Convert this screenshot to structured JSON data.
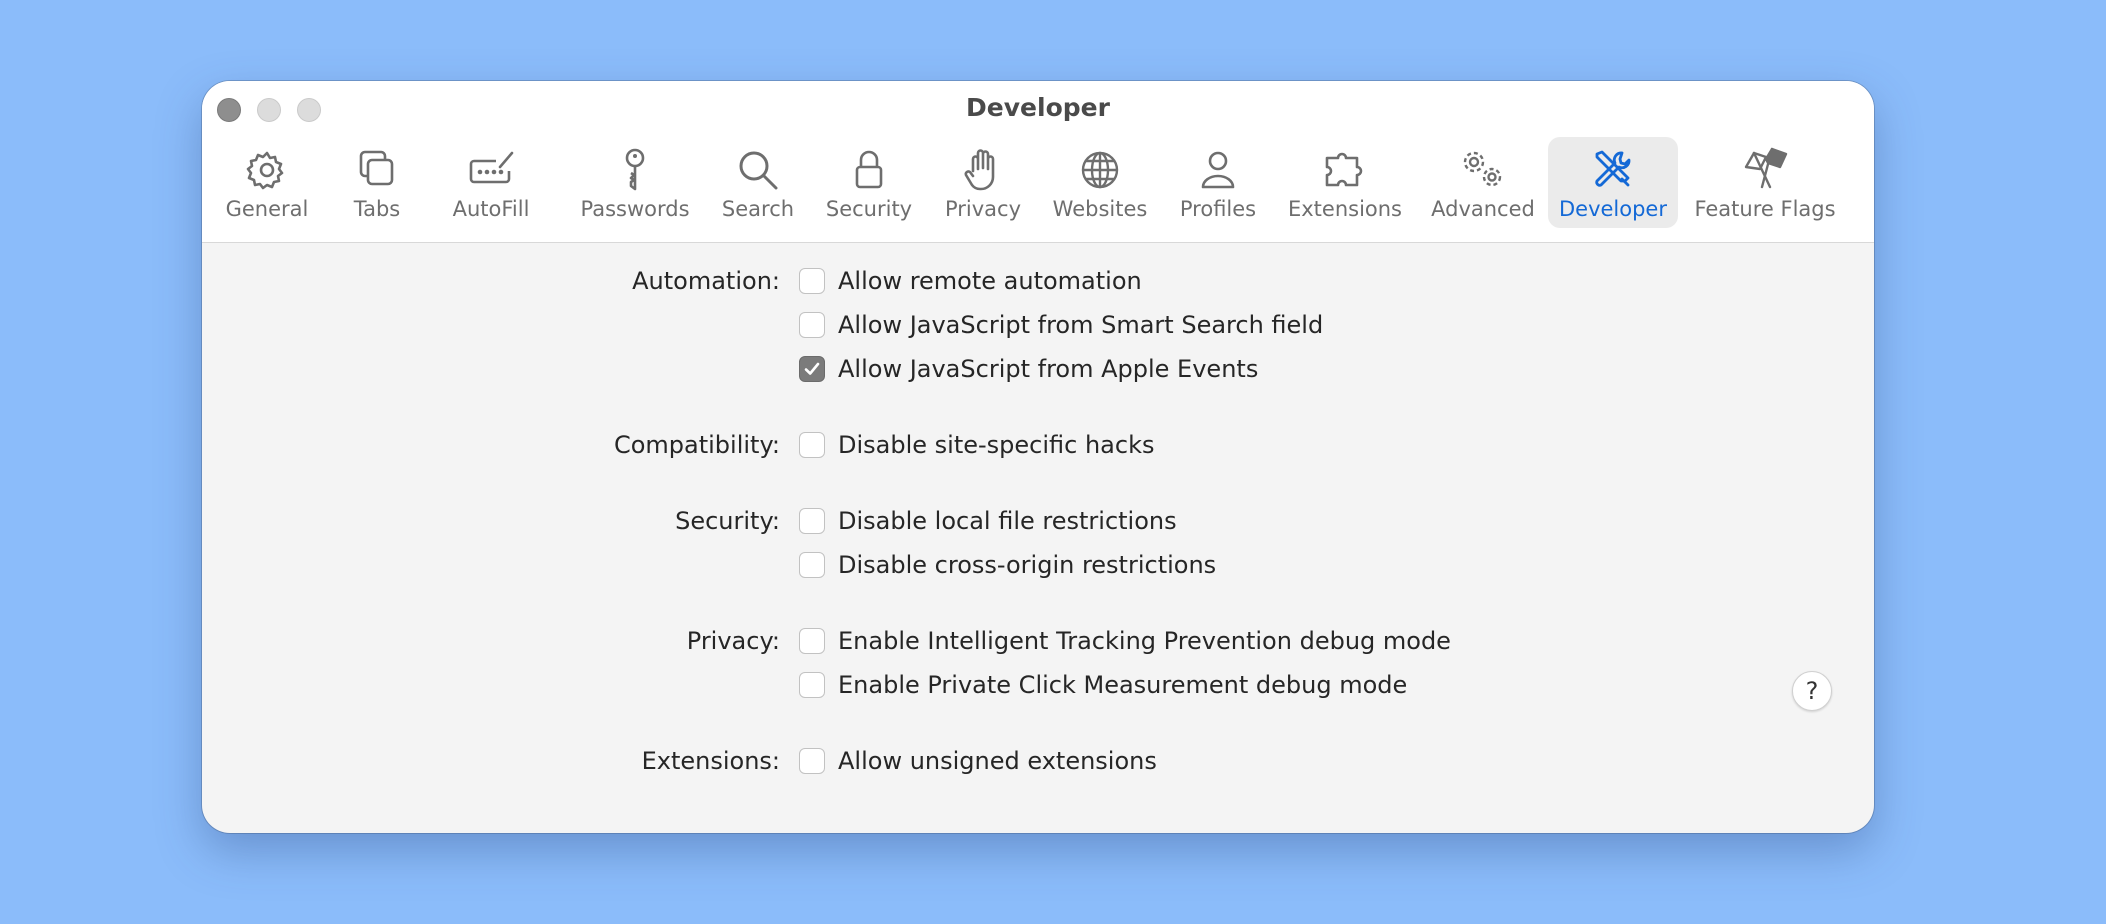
{
  "window": {
    "title": "Developer",
    "accent_color": "#1469d6"
  },
  "toolbar": {
    "items": [
      {
        "label": "General",
        "icon": "gear-icon"
      },
      {
        "label": "Tabs",
        "icon": "tabs-icon"
      },
      {
        "label": "AutoFill",
        "icon": "autofill-icon"
      },
      {
        "label": "Passwords",
        "icon": "key-icon"
      },
      {
        "label": "Search",
        "icon": "magnifier-icon"
      },
      {
        "label": "Security",
        "icon": "lock-icon"
      },
      {
        "label": "Privacy",
        "icon": "hand-icon"
      },
      {
        "label": "Websites",
        "icon": "globe-icon"
      },
      {
        "label": "Profiles",
        "icon": "person-icon"
      },
      {
        "label": "Extensions",
        "icon": "puzzle-icon"
      },
      {
        "label": "Advanced",
        "icon": "gears-icon"
      },
      {
        "label": "Developer",
        "icon": "tools-icon",
        "selected": true
      },
      {
        "label": "Feature Flags",
        "icon": "flags-icon"
      }
    ]
  },
  "settings": {
    "automation": {
      "label": "Automation:",
      "options": [
        {
          "text": "Allow remote automation",
          "checked": false
        },
        {
          "text": "Allow JavaScript from Smart Search field",
          "checked": false
        },
        {
          "text": "Allow JavaScript from Apple Events",
          "checked": true
        }
      ]
    },
    "compatibility": {
      "label": "Compatibility:",
      "options": [
        {
          "text": "Disable site-specific hacks",
          "checked": false
        }
      ]
    },
    "security": {
      "label": "Security:",
      "options": [
        {
          "text": "Disable local file restrictions",
          "checked": false
        },
        {
          "text": "Disable cross-origin restrictions",
          "checked": false
        }
      ]
    },
    "privacy": {
      "label": "Privacy:",
      "options": [
        {
          "text": "Enable Intelligent Tracking Prevention debug mode",
          "checked": false
        },
        {
          "text": "Enable Private Click Measurement debug mode",
          "checked": false
        }
      ]
    },
    "extensions": {
      "label": "Extensions:",
      "options": [
        {
          "text": "Allow unsigned extensions",
          "checked": false
        }
      ]
    }
  },
  "help": {
    "label": "?"
  }
}
